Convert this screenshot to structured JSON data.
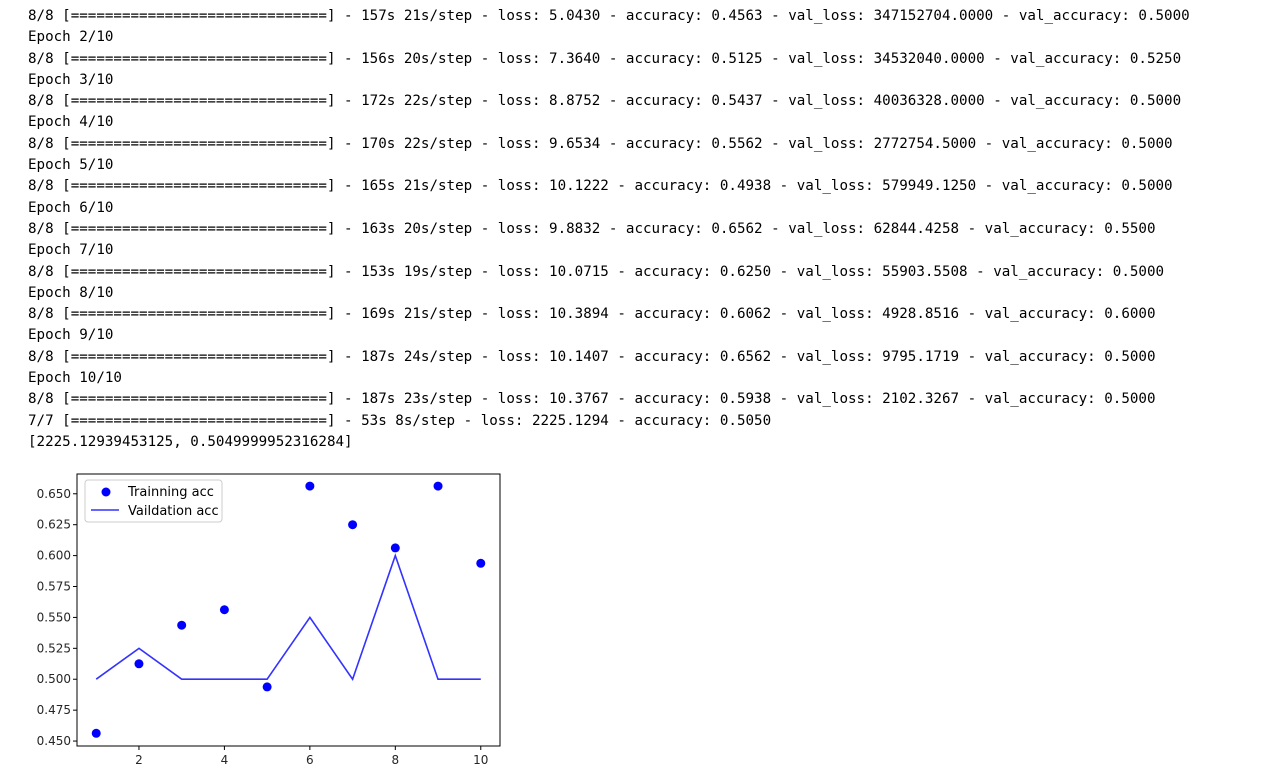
{
  "log": {
    "lines": [
      "8/8 [==============================] - 157s 21s/step - loss: 5.0430 - accuracy: 0.4563 - val_loss: 347152704.0000 - val_accuracy: 0.5000",
      "Epoch 2/10",
      "8/8 [==============================] - 156s 20s/step - loss: 7.3640 - accuracy: 0.5125 - val_loss: 34532040.0000 - val_accuracy: 0.5250",
      "Epoch 3/10",
      "8/8 [==============================] - 172s 22s/step - loss: 8.8752 - accuracy: 0.5437 - val_loss: 40036328.0000 - val_accuracy: 0.5000",
      "Epoch 4/10",
      "8/8 [==============================] - 170s 22s/step - loss: 9.6534 - accuracy: 0.5562 - val_loss: 2772754.5000 - val_accuracy: 0.5000",
      "Epoch 5/10",
      "8/8 [==============================] - 165s 21s/step - loss: 10.1222 - accuracy: 0.4938 - val_loss: 579949.1250 - val_accuracy: 0.5000",
      "Epoch 6/10",
      "8/8 [==============================] - 163s 20s/step - loss: 9.8832 - accuracy: 0.6562 - val_loss: 62844.4258 - val_accuracy: 0.5500",
      "Epoch 7/10",
      "8/8 [==============================] - 153s 19s/step - loss: 10.0715 - accuracy: 0.6250 - val_loss: 55903.5508 - val_accuracy: 0.5000",
      "Epoch 8/10",
      "8/8 [==============================] - 169s 21s/step - loss: 10.3894 - accuracy: 0.6062 - val_loss: 4928.8516 - val_accuracy: 0.6000",
      "Epoch 9/10",
      "8/8 [==============================] - 187s 24s/step - loss: 10.1407 - accuracy: 0.6562 - val_loss: 9795.1719 - val_accuracy: 0.5000",
      "Epoch 10/10",
      "8/8 [==============================] - 187s 23s/step - loss: 10.3767 - accuracy: 0.5938 - val_loss: 2102.3267 - val_accuracy: 0.5000",
      "7/7 [==============================] - 53s 8s/step - loss: 2225.1294 - accuracy: 0.5050",
      "[2225.12939453125, 0.5049999952316284]"
    ]
  },
  "colors": {
    "series": "#0000ff",
    "line": "#3333ff",
    "axis": "#000000",
    "tick_text": "#262626"
  },
  "chart_data": {
    "type": "scatter",
    "x": [
      1,
      2,
      3,
      4,
      5,
      6,
      7,
      8,
      9,
      10
    ],
    "series": [
      {
        "name": "Trainning acc",
        "style": "dots",
        "values": [
          0.4563,
          0.5125,
          0.5437,
          0.5562,
          0.4938,
          0.6562,
          0.625,
          0.6062,
          0.6562,
          0.5938
        ]
      },
      {
        "name": "Vaildation acc",
        "style": "line",
        "values": [
          0.5,
          0.525,
          0.5,
          0.5,
          0.5,
          0.55,
          0.5,
          0.6,
          0.5,
          0.5
        ]
      }
    ],
    "xticks": [
      "2",
      "4",
      "6",
      "8",
      "10"
    ],
    "yticks": [
      "0.450",
      "0.475",
      "0.500",
      "0.525",
      "0.550",
      "0.575",
      "0.600",
      "0.625",
      "0.650"
    ],
    "xlim": [
      0.55,
      10.45
    ],
    "ylim": [
      0.446,
      0.666
    ],
    "legend": "top-left",
    "grid": false,
    "title": "",
    "xlabel": "",
    "ylabel": ""
  }
}
